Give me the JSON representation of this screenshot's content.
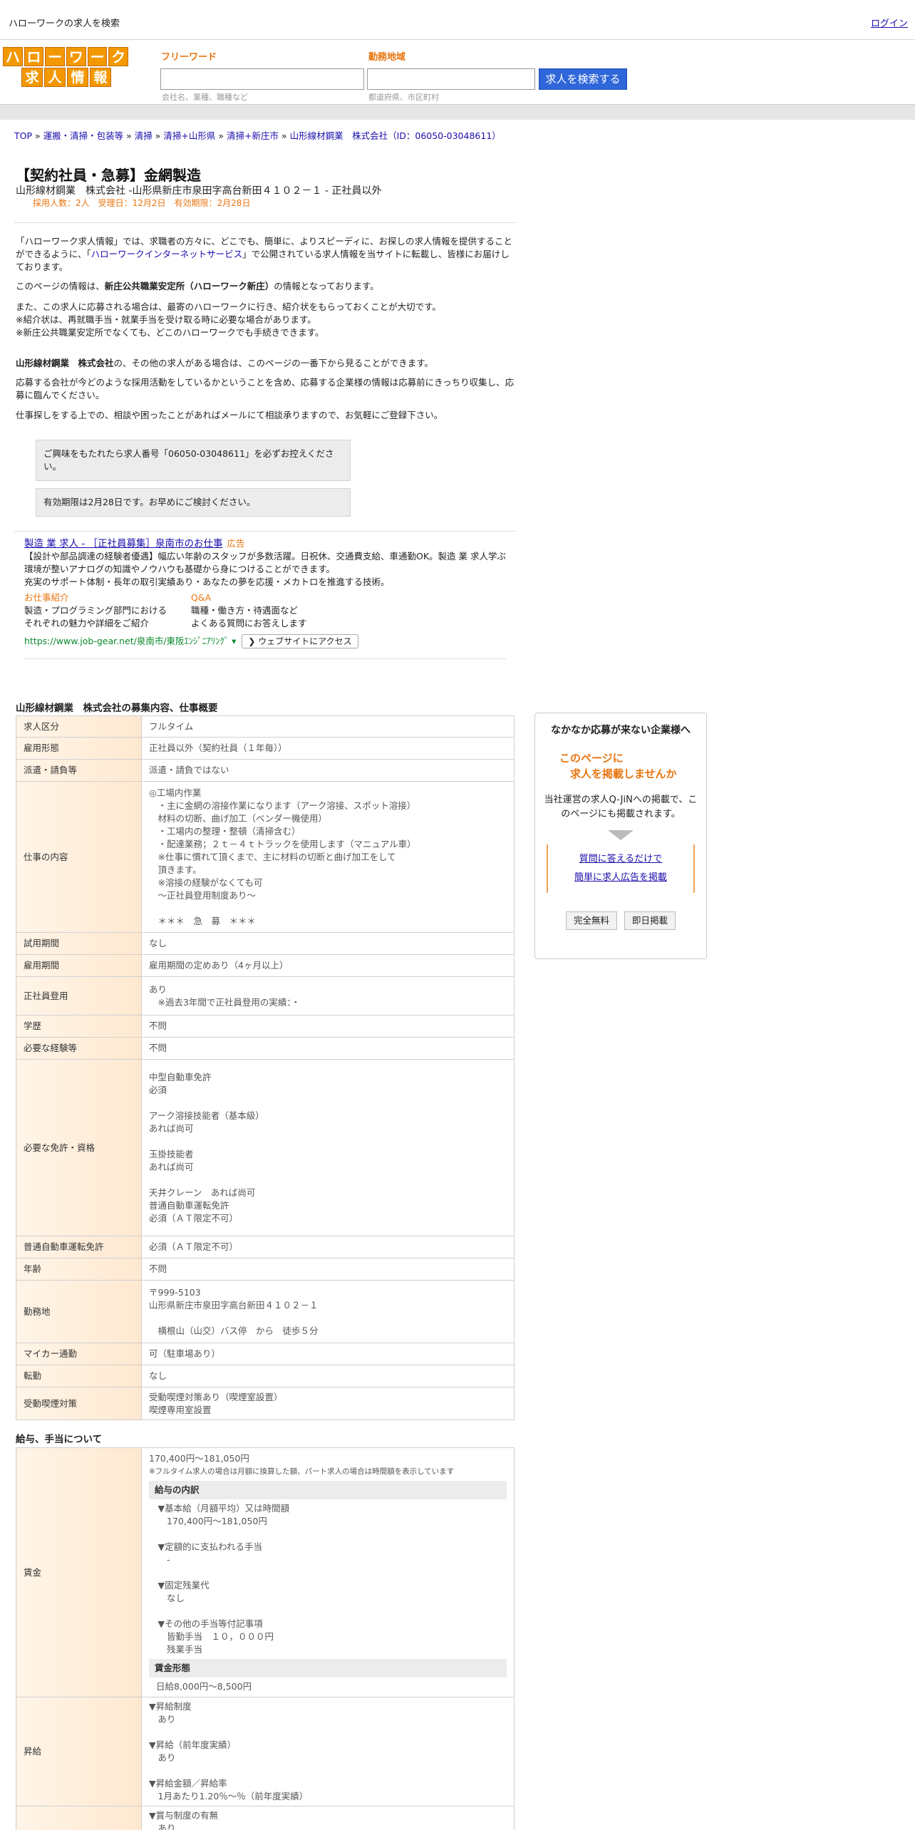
{
  "topbar": {
    "site": "ハローワークの求人を検索",
    "login": "ログイン"
  },
  "logo": {
    "row1": [
      "ハ",
      "ロ",
      "ー",
      "ワ",
      "ー",
      "ク"
    ],
    "row2": [
      "求",
      "人",
      "情",
      "報"
    ]
  },
  "search": {
    "freeword_label": "フリーワード",
    "freeword_hint": "会社名、業種、職種など",
    "area_label": "勤務地域",
    "area_hint": "都道府県、市区町村",
    "button": "求人を検索する"
  },
  "breadcrumb": {
    "items": [
      "TOP",
      "運搬・清掃・包装等",
      "清掃",
      "清掃+山形県",
      "清掃+新庄市",
      "山形線材鋼業　株式会社（ID：06050-03048611）"
    ],
    "sep": " » "
  },
  "job": {
    "title": "【契約社員・急募】金網製造",
    "subtitle": "山形線材鋼業　株式会社 -山形県新庄市泉田字高台新田４１０２－１ - 正社員以外",
    "meta": "採用人数：2人　受理日：12月2日　有効期限：2月28日"
  },
  "intro": {
    "p1a": "「ハローワーク求人情報」では、求職者の方々に、どこでも、簡単に、よりスピーディに、お探しの求人情報を提供することができるように、「",
    "p1link": "ハローワークインターネットサービス",
    "p1b": "」で公開されている求人情報を当サイトに転載し、皆様にお届けしております。",
    "p2a": "このページの情報は、",
    "p2b": "新庄公共職業安定所（ハローワーク新庄）",
    "p2c": "の情報となっております。",
    "p3": "また、この求人に応募される場合は、最寄のハローワークに行き、紹介状をもらっておくことが大切です。",
    "p4": "※紹介状は、再就職手当・就業手当を受け取る時に必要な場合があります。",
    "p5": "※新庄公共職業安定所でなくても、どこのハローワークでも手続きできます。",
    "p6a": "山形線材鋼業　株式会社",
    "p6b": "の、その他の求人がある場合は、このページの一番下から見ることができます。",
    "p7": "応募する会社が今どのような採用活動をしているかということを含め、応募する企業様の情報は応募前にきっちり収集し、応募に臨んでください。",
    "p8": "仕事探しをする上での、相談や困ったことがあればメールにて相談承りますので、お気軽にご登録下さい。"
  },
  "notes": {
    "n1": "ご興味をもたれたら求人番号「06050-03048611」を必ずお控えください。",
    "n2": "有効期限は2月28日です。お早めにご検討ください。"
  },
  "ad": {
    "title": "製造 業 求人 - ［正社員募集］泉南市のお仕事",
    "tag": "広告",
    "desc1": "【設計や部品調達の経験者優遇】幅広い年齢のスタッフが多数活躍。日祝休、交通費支給、車通勤OK。製造 業 求人学ぶ環境が整いアナログの知識やノウハウも基礎から身につけることができます。",
    "desc2": "充実のサポート体制・長年の取引実績あり・あなたの夢を応援・メカトロを推進する技術。",
    "col1_title": "お仕事紹介",
    "col1_a": "製造・プログラミング部門における",
    "col1_b": "それぞれの魅力や詳細をご紹介",
    "col2_title": "Q&A",
    "col2_a": "職種・働き方・待遇面など",
    "col2_b": "よくある質問にお答えします",
    "url": "https://www.job-gear.net/泉南市/東阪ｴﾝｼﾞﾆｱﾘﾝｸﾞ",
    "visit": "❯ ウェブサイトにアクセス"
  },
  "section1": {
    "title": "山形線材鋼業　株式会社の募集内容、仕事概要",
    "rows": [
      {
        "label": "求人区分",
        "value": "フルタイム"
      },
      {
        "label": "雇用形態",
        "value": "正社員以外（契約社員（１年毎））"
      },
      {
        "label": "派遣・請負等",
        "value": "派遣・請負ではない"
      },
      {
        "label": "仕事の内容",
        "value": "◎工場内作業\n　・主に金網の溶接作業になります（アーク溶接、スポット溶接）\n　材料の切断、曲げ加工（ベンダー機使用）\n　・工場内の整理・整頓（清掃含む）\n　・配達業務；２ｔ－４ｔトラックを使用します（マニュアル車）\n　※仕事に慣れて頂くまで、主に材料の切断と曲げ加工をして\n　頂きます。\n　※溶接の経験がなくても可\n　～正社員登用制度あり～\n\n　＊＊＊　急　募　＊＊＊"
      },
      {
        "label": "試用期間",
        "value": "なし"
      },
      {
        "label": "雇用期間",
        "value": "雇用期間の定めあり（4ヶ月以上）"
      },
      {
        "label": "正社員登用",
        "value": "あり\n　※過去3年間で正社員登用の実績：・"
      },
      {
        "label": "学歴",
        "value": "不問"
      },
      {
        "label": "必要な経験等",
        "value": "不問"
      },
      {
        "label": "必要な免許・資格",
        "value": "中型自動車免許\n必須\n\nアーク溶接技能者（基本級）\nあれば尚可\n\n玉掛技能者\nあれば尚可\n\n天井クレーン　あれば尚可\n普通自動車運転免許\n必須（ＡＴ限定不可）"
      },
      {
        "label": "普通自動車運転免許",
        "value": "必須（ＡＴ限定不可）"
      },
      {
        "label": "年齢",
        "value": "不問"
      },
      {
        "label": "勤務地",
        "value": "〒999-5103\n山形県新庄市泉田字高台新田４１０２－１\n\n　横根山（山交）バス停　から　徒歩５分"
      },
      {
        "label": "マイカー通勤",
        "value": "可（駐車場あり）"
      },
      {
        "label": "転勤",
        "value": "なし"
      },
      {
        "label": "受動喫煙対策",
        "value": "受動喫煙対策あり（喫煙室設置）\n喫煙専用室設置"
      }
    ]
  },
  "section2": {
    "title": "給与、手当について",
    "wage_label": "賃金",
    "wage_range": "170,400円〜181,050円",
    "wage_note": "※フルタイム求人の場合は月額に換算した額、パート求人の場合は時間額を表示しています",
    "wage_breakdown_head": "給与の内訳",
    "wage_breakdown": "　▼基本給（月額平均）又は時間額\n　　170,400円〜181,050円\n\n　▼定額的に支払われる手当\n　　-\n\n　▼固定残業代\n　　なし\n\n　▼その他の手当等付記事項\n　　皆勤手当　１０，０００円\n　　残業手当",
    "wage_form_head": "賃金形態",
    "wage_form": "日給8,000円〜8,500円",
    "raise_label": "昇給",
    "raise_value": "▼昇給制度\n　あり\n\n▼昇給（前年度実績）\n　あり\n\n▼昇給金額／昇給率\n　1月あたり1.20％〜％（前年度実績）",
    "bonus_value": "▼賞与制度の有無\n　あり"
  },
  "side": {
    "title": "なかなか応募が来ない企業様へ",
    "catch1": "このページに",
    "catch2": "　求人を掲載しませんか",
    "desc": "当社運営の求人Q-JiNへの掲載で、このページにも掲載されます。",
    "link1": "質問に答えるだけで",
    "link2": "簡単に求人広告を掲載",
    "btn1": "完全無料",
    "btn2": "即日掲載"
  }
}
